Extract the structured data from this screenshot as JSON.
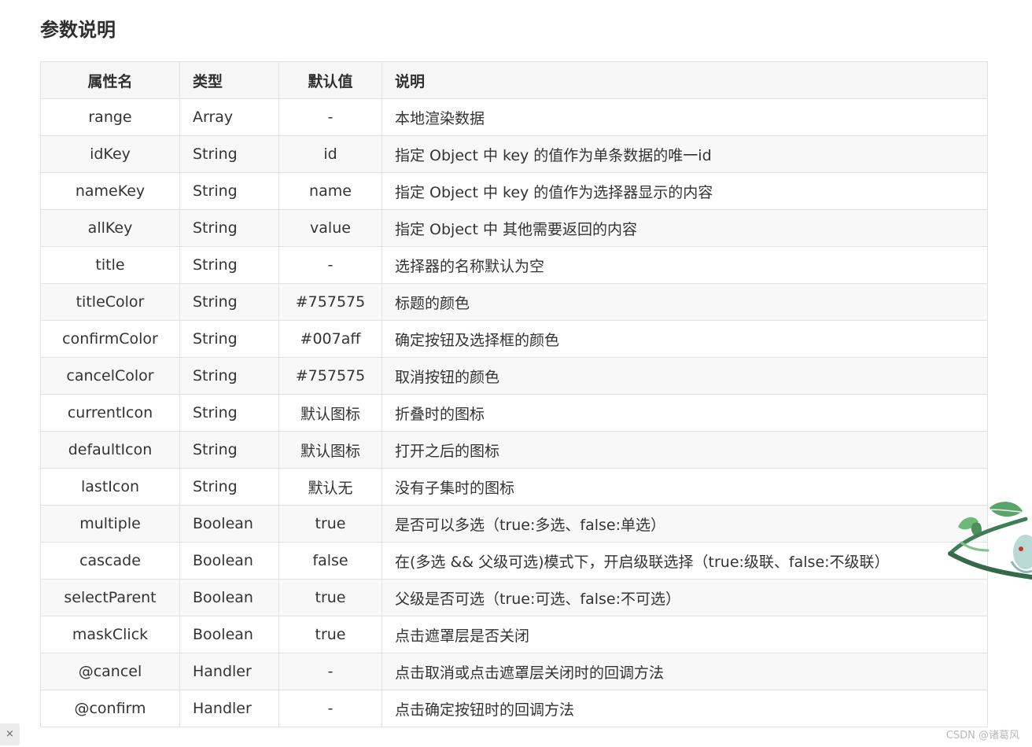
{
  "heading": "参数说明",
  "table": {
    "headers": {
      "name": "属性名",
      "type": "类型",
      "default": "默认值",
      "desc": "说明"
    },
    "rows": [
      {
        "name": "range",
        "type": "Array",
        "default": "-",
        "desc": "本地渲染数据"
      },
      {
        "name": "idKey",
        "type": "String",
        "default": "id",
        "desc": "指定 Object 中 key 的值作为单条数据的唯一id"
      },
      {
        "name": "nameKey",
        "type": "String",
        "default": "name",
        "desc": "指定 Object 中 key 的值作为选择器显示的内容"
      },
      {
        "name": "allKey",
        "type": "String",
        "default": "value",
        "desc": "指定 Object 中 其他需要返回的内容"
      },
      {
        "name": "title",
        "type": "String",
        "default": "-",
        "desc": "选择器的名称默认为空"
      },
      {
        "name": "titleColor",
        "type": "String",
        "default": "#757575",
        "desc": "标题的颜色"
      },
      {
        "name": "confirmColor",
        "type": "String",
        "default": "#007aff",
        "desc": "确定按钮及选择框的颜色"
      },
      {
        "name": "cancelColor",
        "type": "String",
        "default": "#757575",
        "desc": "取消按钮的颜色"
      },
      {
        "name": "currentIcon",
        "type": "String",
        "default": "默认图标",
        "desc": "折叠时的图标"
      },
      {
        "name": "defaultIcon",
        "type": "String",
        "default": "默认图标",
        "desc": "打开之后的图标"
      },
      {
        "name": "lastIcon",
        "type": "String",
        "default": "默认无",
        "desc": "没有子集时的图标"
      },
      {
        "name": "multiple",
        "type": "Boolean",
        "default": "true",
        "desc": "是否可以多选（true:多选、false:单选）"
      },
      {
        "name": "cascade",
        "type": "Boolean",
        "default": "false",
        "desc": "在(多选 && 父级可选)模式下，开启级联选择（true:级联、false:不级联）"
      },
      {
        "name": "selectParent",
        "type": "Boolean",
        "default": "true",
        "desc": "父级是否可选（true:可选、false:不可选）"
      },
      {
        "name": "maskClick",
        "type": "Boolean",
        "default": "true",
        "desc": "点击遮罩层是否关闭"
      },
      {
        "name": "@cancel",
        "type": "Handler",
        "default": "-",
        "desc": "点击取消或点击遮罩层关闭时的回调方法"
      },
      {
        "name": "@confirm",
        "type": "Handler",
        "default": "-",
        "desc": "点击确定按钮时的回调方法"
      }
    ]
  },
  "watermark": "CSDN @诸葛风",
  "close_tab": {
    "glyph": "×"
  },
  "mascot": {
    "icon": "leaf-creature-illustration",
    "leaf_color": "#5aa469",
    "body_color": "#b9d9d4"
  }
}
